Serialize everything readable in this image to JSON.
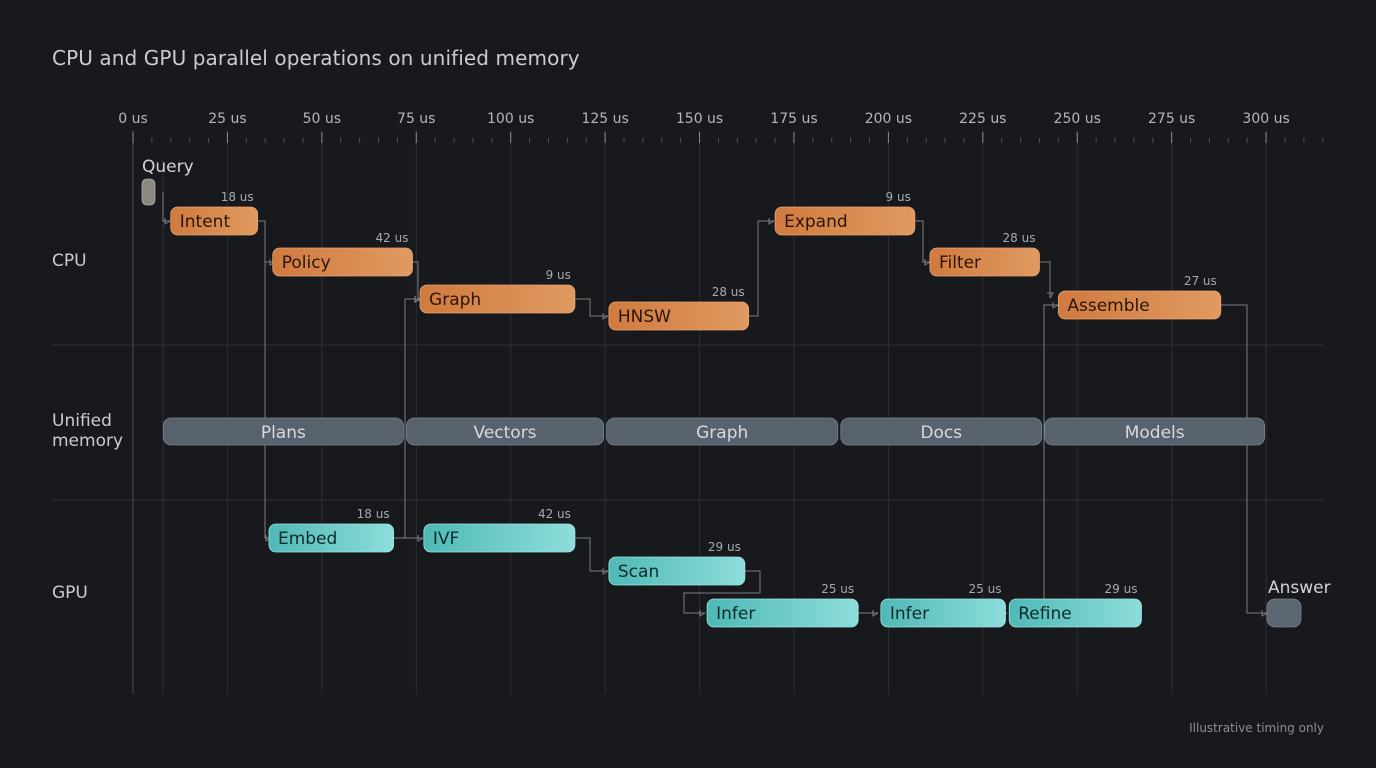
{
  "title": "CPU and GPU parallel operations on unified memory",
  "footnote": "Illustrative timing only",
  "colors": {
    "background": "#17191d",
    "cpu": "#d4844a",
    "gpu": "#6fcfce",
    "memory": "#58626d",
    "marker": "#8e8780",
    "answer": "#5c6671"
  },
  "timeline": {
    "ticks": [
      "0 us",
      "25 us",
      "50 us",
      "75 us",
      "100 us",
      "125 us",
      "150 us",
      "175 us",
      "200 us",
      "225 us",
      "250 us",
      "275 us",
      "300 us"
    ]
  },
  "lanes": {
    "cpu": "CPU",
    "memory": "Unified\nmemory",
    "gpu": "GPU"
  },
  "markers": {
    "query": "Query",
    "answer": "Answer"
  },
  "chart_data": {
    "type": "gantt",
    "x_unit": "us",
    "x_range": [
      0,
      300
    ],
    "tasks": [
      {
        "id": "intent",
        "lane": "CPU",
        "label": "Intent",
        "duration": "18 us",
        "start": 10,
        "end": 33
      },
      {
        "id": "policy",
        "lane": "CPU",
        "label": "Policy",
        "duration": "42 us",
        "start": 37,
        "end": 74
      },
      {
        "id": "graph_cpu",
        "lane": "CPU",
        "label": "Graph",
        "duration": "9 us",
        "start": 76,
        "end": 117
      },
      {
        "id": "hnsw",
        "lane": "CPU",
        "label": "HNSW",
        "duration": "28 us",
        "start": 126,
        "end": 163
      },
      {
        "id": "expand",
        "lane": "CPU",
        "label": "Expand",
        "duration": "9 us",
        "start": 170,
        "end": 207
      },
      {
        "id": "filter",
        "lane": "CPU",
        "label": "Filter",
        "duration": "28 us",
        "start": 211,
        "end": 240
      },
      {
        "id": "assemble",
        "lane": "CPU",
        "label": "Assemble",
        "duration": "27 us",
        "start": 245,
        "end": 288
      },
      {
        "id": "embed",
        "lane": "GPU",
        "label": "Embed",
        "duration": "18 us",
        "start": 36,
        "end": 69
      },
      {
        "id": "ivf",
        "lane": "GPU",
        "label": "IVF",
        "duration": "42 us",
        "start": 77,
        "end": 117
      },
      {
        "id": "scan",
        "lane": "GPU",
        "label": "Scan",
        "duration": "29 us",
        "start": 126,
        "end": 162
      },
      {
        "id": "infer1",
        "lane": "GPU",
        "label": "Infer",
        "duration": "25 us",
        "start": 152,
        "end": 192
      },
      {
        "id": "infer2",
        "lane": "GPU",
        "label": "Infer",
        "duration": "25 us",
        "start": 198,
        "end": 231
      },
      {
        "id": "refine",
        "lane": "GPU",
        "label": "Refine",
        "duration": "29 us",
        "start": 232,
        "end": 267
      }
    ],
    "memory_regions": [
      {
        "label": "Plans",
        "start": 8,
        "end": 72
      },
      {
        "label": "Vectors",
        "start": 72,
        "end": 125
      },
      {
        "label": "Graph",
        "start": 125,
        "end": 187
      },
      {
        "label": "Docs",
        "start": 187,
        "end": 241
      },
      {
        "label": "Models",
        "start": 241,
        "end": 300
      }
    ],
    "dependencies": [
      [
        "query",
        "intent"
      ],
      [
        "intent",
        "policy"
      ],
      [
        "policy",
        "graph_cpu"
      ],
      [
        "policy",
        "embed"
      ],
      [
        "embed",
        "ivf"
      ],
      [
        "ivf",
        "graph_cpu"
      ],
      [
        "graph_cpu",
        "hnsw"
      ],
      [
        "ivf",
        "scan"
      ],
      [
        "hnsw",
        "expand"
      ],
      [
        "scan",
        "infer1"
      ],
      [
        "expand",
        "filter"
      ],
      [
        "infer1",
        "infer2"
      ],
      [
        "infer2",
        "refine"
      ],
      [
        "filter",
        "assemble"
      ],
      [
        "refine",
        "assemble"
      ],
      [
        "assemble",
        "answer"
      ]
    ]
  }
}
